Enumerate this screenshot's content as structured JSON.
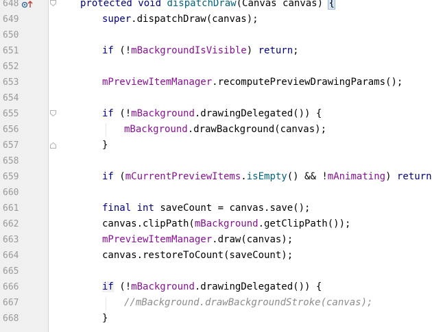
{
  "line_numbers": [
    "648",
    "649",
    "650",
    "651",
    "652",
    "653",
    "654",
    "655",
    "656",
    "657",
    "658",
    "659",
    "660",
    "661",
    "662",
    "663",
    "664",
    "665",
    "666",
    "667",
    "668"
  ],
  "code": {
    "l648": {
      "kw1": "protected",
      "kw2": "void",
      "fn": "dispatchDraw",
      "args": "(Canvas canvas) ",
      "brace": "{"
    },
    "l649": {
      "kw": "super",
      "rest": ".dispatchDraw(canvas);"
    },
    "l651": {
      "kw": "if",
      "mid": " (!",
      "fld": "mBackgroundIsVisible",
      "close": ") ",
      "ret": "return",
      ";": ";"
    },
    "l653": {
      "fld": "mPreviewItemManager",
      "rest": ".recomputePreviewDrawingParams();"
    },
    "l655": {
      "kw": "if",
      "mid": " (!",
      "fld": "mBackground",
      "rest": ".drawingDelegated()) {"
    },
    "l656": {
      "fld": "mBackground",
      "rest": ".drawBackground(canvas);"
    },
    "l657": {
      "text": "}"
    },
    "l659": {
      "kw": "if",
      "mid": " (",
      "fld": "mCurrentPreviewItems",
      "dot": ".",
      "mth": "isEmpty",
      "rest1": "() && !",
      "fld2": "mAnimating",
      "close": ") ",
      "ret": "return",
      "end": ";"
    },
    "l661": {
      "kw1": "final",
      "kw2": "int",
      "rest": " saveCount = canvas.save();"
    },
    "l662": {
      "pre": "canvas.clipPath(",
      "fld": "mBackground",
      "rest": ".getClipPath());"
    },
    "l663": {
      "fld": "mPreviewItemManager",
      "rest": ".draw(canvas);"
    },
    "l664": {
      "text": "canvas.restoreToCount(saveCount);"
    },
    "l666": {
      "kw": "if",
      "mid": " (!",
      "fld": "mBackground",
      "rest": ".drawingDelegated()) {"
    },
    "l667": {
      "text": "//mBackground.drawBackgroundStroke(canvas);"
    },
    "l668": {
      "text": "}"
    }
  },
  "icons": {
    "gutter_marker": "breakpoint-override-icon",
    "fold": "fold-marker-icon"
  }
}
